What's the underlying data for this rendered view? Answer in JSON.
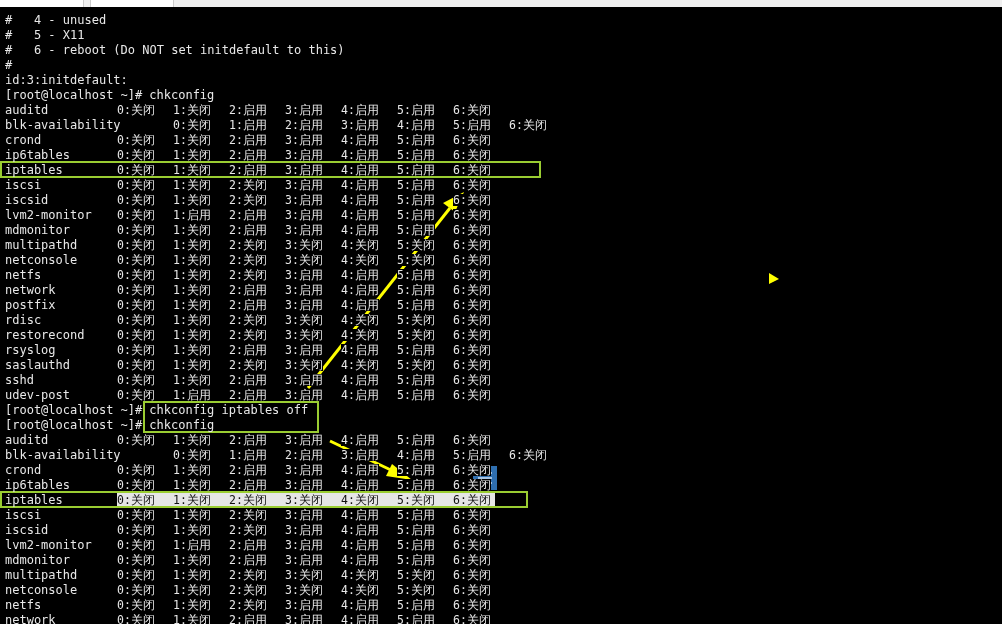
{
  "lines": [
    {
      "kind": "text",
      "text": "#   4 - unused"
    },
    {
      "kind": "text",
      "text": "#   5 - X11"
    },
    {
      "kind": "text",
      "text": "#   6 - reboot (Do NOT set initdefault to this)"
    },
    {
      "kind": "text",
      "text": "#"
    },
    {
      "kind": "text",
      "text": "id:3:initdefault:"
    },
    {
      "kind": "prompt",
      "prompt": "[root@localhost ~]#",
      "command": "chkconfig"
    },
    {
      "kind": "service",
      "name": "auditd",
      "states": [
        "0:关闭",
        "1:关闭",
        "2:启用",
        "3:启用",
        "4:启用",
        "5:启用",
        "6:关闭"
      ],
      "selected": false
    },
    {
      "kind": "service",
      "name": "blk-availability",
      "states": [
        "0:关闭",
        "1:启用",
        "2:启用",
        "3:启用",
        "4:启用",
        "5:启用",
        "6:关闭"
      ],
      "selected": false
    },
    {
      "kind": "service",
      "name": "crond",
      "states": [
        "0:关闭",
        "1:关闭",
        "2:启用",
        "3:启用",
        "4:启用",
        "5:启用",
        "6:关闭"
      ],
      "selected": false
    },
    {
      "kind": "service",
      "name": "ip6tables",
      "states": [
        "0:关闭",
        "1:关闭",
        "2:启用",
        "3:启用",
        "4:启用",
        "5:启用",
        "6:关闭"
      ],
      "selected": false
    },
    {
      "kind": "service",
      "name": "iptables",
      "states": [
        "0:关闭",
        "1:关闭",
        "2:启用",
        "3:启用",
        "4:启用",
        "5:启用",
        "6:关闭"
      ],
      "selected": false
    },
    {
      "kind": "service",
      "name": "iscsi",
      "states": [
        "0:关闭",
        "1:关闭",
        "2:关闭",
        "3:启用",
        "4:启用",
        "5:启用",
        "6:关闭"
      ],
      "selected": false
    },
    {
      "kind": "service",
      "name": "iscsid",
      "states": [
        "0:关闭",
        "1:关闭",
        "2:关闭",
        "3:启用",
        "4:启用",
        "5:启用",
        "6:关闭"
      ],
      "selected": false
    },
    {
      "kind": "service",
      "name": "lvm2-monitor",
      "states": [
        "0:关闭",
        "1:启用",
        "2:启用",
        "3:启用",
        "4:启用",
        "5:启用",
        "6:关闭"
      ],
      "selected": false
    },
    {
      "kind": "service",
      "name": "mdmonitor",
      "states": [
        "0:关闭",
        "1:关闭",
        "2:启用",
        "3:启用",
        "4:启用",
        "5:启用",
        "6:关闭"
      ],
      "selected": false
    },
    {
      "kind": "service",
      "name": "multipathd",
      "states": [
        "0:关闭",
        "1:关闭",
        "2:关闭",
        "3:关闭",
        "4:关闭",
        "5:关闭",
        "6:关闭"
      ],
      "selected": false
    },
    {
      "kind": "service",
      "name": "netconsole",
      "states": [
        "0:关闭",
        "1:关闭",
        "2:关闭",
        "3:关闭",
        "4:关闭",
        "5:关闭",
        "6:关闭"
      ],
      "selected": false
    },
    {
      "kind": "service",
      "name": "netfs",
      "states": [
        "0:关闭",
        "1:关闭",
        "2:关闭",
        "3:启用",
        "4:启用",
        "5:启用",
        "6:关闭"
      ],
      "selected": false
    },
    {
      "kind": "service",
      "name": "network",
      "states": [
        "0:关闭",
        "1:关闭",
        "2:启用",
        "3:启用",
        "4:启用",
        "5:启用",
        "6:关闭"
      ],
      "selected": false
    },
    {
      "kind": "service",
      "name": "postfix",
      "states": [
        "0:关闭",
        "1:关闭",
        "2:启用",
        "3:启用",
        "4:启用",
        "5:启用",
        "6:关闭"
      ],
      "selected": false
    },
    {
      "kind": "service",
      "name": "rdisc",
      "states": [
        "0:关闭",
        "1:关闭",
        "2:关闭",
        "3:关闭",
        "4:关闭",
        "5:关闭",
        "6:关闭"
      ],
      "selected": false
    },
    {
      "kind": "service",
      "name": "restorecond",
      "states": [
        "0:关闭",
        "1:关闭",
        "2:关闭",
        "3:关闭",
        "4:关闭",
        "5:关闭",
        "6:关闭"
      ],
      "selected": false
    },
    {
      "kind": "service",
      "name": "rsyslog",
      "states": [
        "0:关闭",
        "1:关闭",
        "2:启用",
        "3:启用",
        "4:启用",
        "5:启用",
        "6:关闭"
      ],
      "selected": false
    },
    {
      "kind": "service",
      "name": "saslauthd",
      "states": [
        "0:关闭",
        "1:关闭",
        "2:关闭",
        "3:关闭",
        "4:关闭",
        "5:关闭",
        "6:关闭"
      ],
      "selected": false
    },
    {
      "kind": "service",
      "name": "sshd",
      "states": [
        "0:关闭",
        "1:关闭",
        "2:启用",
        "3:启用",
        "4:启用",
        "5:启用",
        "6:关闭"
      ],
      "selected": false
    },
    {
      "kind": "service",
      "name": "udev-post",
      "states": [
        "0:关闭",
        "1:启用",
        "2:启用",
        "3:启用",
        "4:启用",
        "5:启用",
        "6:关闭"
      ],
      "selected": false
    },
    {
      "kind": "prompt",
      "prompt": "[root@localhost ~]#",
      "command": "chkconfig iptables off"
    },
    {
      "kind": "prompt",
      "prompt": "[root@localhost ~]#",
      "command": "chkconfig"
    },
    {
      "kind": "service",
      "name": "auditd",
      "states": [
        "0:关闭",
        "1:关闭",
        "2:启用",
        "3:启用",
        "4:启用",
        "5:启用",
        "6:关闭"
      ],
      "selected": false
    },
    {
      "kind": "service",
      "name": "blk-availability",
      "states": [
        "0:关闭",
        "1:启用",
        "2:启用",
        "3:启用",
        "4:启用",
        "5:启用",
        "6:关闭"
      ],
      "selected": false
    },
    {
      "kind": "service",
      "name": "crond",
      "states": [
        "0:关闭",
        "1:关闭",
        "2:启用",
        "3:启用",
        "4:启用",
        "5:启用",
        "6:关闭"
      ],
      "selected": false
    },
    {
      "kind": "service",
      "name": "ip6tables",
      "states": [
        "0:关闭",
        "1:关闭",
        "2:启用",
        "3:启用",
        "4:启用",
        "5:启用",
        "6:关闭"
      ],
      "selected": false
    },
    {
      "kind": "service",
      "name": "iptables",
      "states": [
        "0:关闭",
        "1:关闭",
        "2:关闭",
        "3:关闭",
        "4:关闭",
        "5:关闭",
        "6:关闭"
      ],
      "selected": true
    },
    {
      "kind": "service",
      "name": "iscsi",
      "states": [
        "0:关闭",
        "1:关闭",
        "2:关闭",
        "3:启用",
        "4:启用",
        "5:启用",
        "6:关闭"
      ],
      "selected": false
    },
    {
      "kind": "service",
      "name": "iscsid",
      "states": [
        "0:关闭",
        "1:关闭",
        "2:关闭",
        "3:启用",
        "4:启用",
        "5:启用",
        "6:关闭"
      ],
      "selected": false
    },
    {
      "kind": "service",
      "name": "lvm2-monitor",
      "states": [
        "0:关闭",
        "1:启用",
        "2:启用",
        "3:启用",
        "4:启用",
        "5:启用",
        "6:关闭"
      ],
      "selected": false
    },
    {
      "kind": "service",
      "name": "mdmonitor",
      "states": [
        "0:关闭",
        "1:关闭",
        "2:启用",
        "3:启用",
        "4:启用",
        "5:启用",
        "6:关闭"
      ],
      "selected": false
    },
    {
      "kind": "service",
      "name": "multipathd",
      "states": [
        "0:关闭",
        "1:关闭",
        "2:关闭",
        "3:关闭",
        "4:关闭",
        "5:关闭",
        "6:关闭"
      ],
      "selected": false
    },
    {
      "kind": "service",
      "name": "netconsole",
      "states": [
        "0:关闭",
        "1:关闭",
        "2:关闭",
        "3:关闭",
        "4:关闭",
        "5:关闭",
        "6:关闭"
      ],
      "selected": false
    },
    {
      "kind": "service",
      "name": "netfs",
      "states": [
        "0:关闭",
        "1:关闭",
        "2:关闭",
        "3:启用",
        "4:启用",
        "5:启用",
        "6:关闭"
      ],
      "selected": false
    },
    {
      "kind": "service",
      "name": "network",
      "states": [
        "0:关闭",
        "1:关闭",
        "2:启用",
        "3:启用",
        "4:启用",
        "5:启用",
        "6:关闭"
      ],
      "selected": false
    }
  ]
}
